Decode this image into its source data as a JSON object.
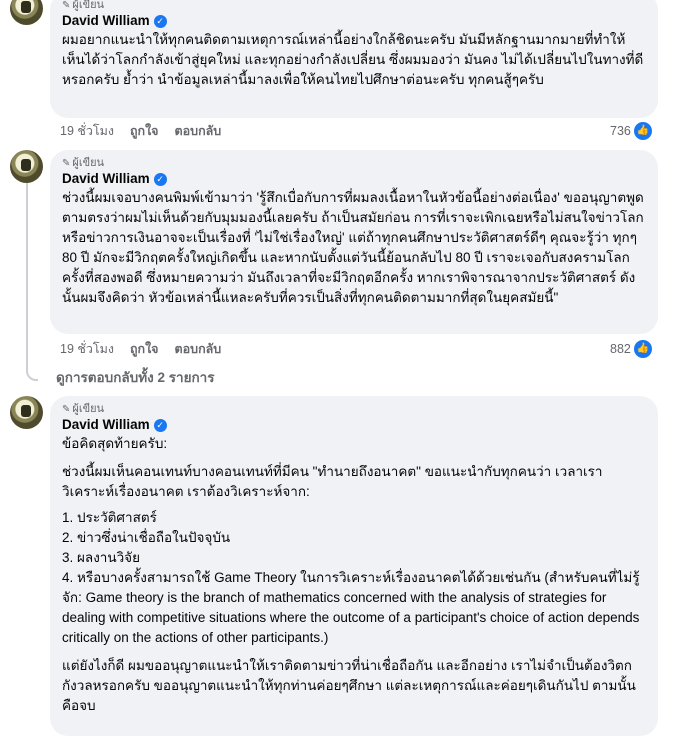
{
  "comments": [
    {
      "badge": "ผู้เขียน",
      "author": "David William",
      "text": "ผมอยากแนะนำให้ทุกคนติดตามเหตุการณ์เหล่านี้อย่างใกล้ชิดนะครับ มันมีหลักฐานมากมายที่ทำให้เห็นได้ว่าโลกกำลังเข้าสู่ยุคใหม่ และทุกอย่างกำลังเปลี่ยน ซึ่งผมมองว่า มันคง ไม่ได้เปลี่ยนไปในทางที่ดีหรอกครับ ย้ำว่า นำข้อมูลเหล่านี้มาลงเพื่อให้คนไทยไปศึกษาต่อนะครับ ทุกคนสู้ๆครับ",
      "time": "19 ชั่วโมง",
      "like": "ถูกใจ",
      "reply": "ตอบกลับ",
      "reactions": "736"
    },
    {
      "badge": "ผู้เขียน",
      "author": "David William",
      "text": "ช่วงนี้ผมเจอบางคนพิมพ์เข้ามาว่า 'รู้สึกเบื่อกับการที่ผมลงเนื้อหาในหัวข้อนี้อย่างต่อเนื่อง' ขออนุญาตพูดตามตรงว่าผมไม่เห็นด้วยกับมุมมองนี้เลยครับ ถ้าเป็นสมัยก่อน การที่เราจะเพิกเฉยหรือไม่สนใจข่าวโลกหรือข่าวการเงินอาจจะเป็นเรื่องที่ 'ไม่ใช่เรื่องใหญ่' แต่ถ้าทุกคนศึกษาประวัติศาสตร์ดีๆ คุณจะรู้ว่า ทุกๆ 80 ปี มักจะมีวิกฤตครั้งใหญ่เกิดขึ้น และหากนับตั้งแต่วันนี้ย้อนกลับไป 80 ปี เราจะเจอกับสงครามโลกครั้งที่สองพอดี ซึ่งหมายความว่า มันถึงเวลาที่จะมีวิกฤตอีกครั้ง หากเราพิจารณาจากประวัติศาสตร์ ดังนั้นผมจึงคิดว่า หัวข้อเหล่านี้แหละครับที่ควรเป็นสิ่งที่ทุกคนติดตามมากที่สุดในยุคสมัยนี้\"",
      "time": "19 ชั่วโมง",
      "like": "ถูกใจ",
      "reply": "ตอบกลับ",
      "reactions": "882"
    }
  ],
  "view_replies": "ดูการตอบกลับทั้ง 2 รายการ",
  "final_comment": {
    "badge": "ผู้เขียน",
    "author": "David William",
    "heading": "ข้อคิดสุดท้ายครับ:",
    "intro": "ช่วงนี้ผมเห็นคอนเทนท์บางคอนเทนท์ที่มีคน \"ทำนายถึงอนาคต\" ขอแนะนำกับทุกคนว่า เวลาเราวิเคราะห์เรื่องอนาคต เราต้องวิเคราะห์จาก:",
    "items": [
      "1. ประวัติศาสตร์",
      "2. ข่าวซึ่งน่าเชื่อถือในปัจจุบัน",
      "3. ผลงานวิจัย",
      "4. หรือบางครั้งสามารถใช้ Game Theory ในการวิเคราะห์เรื่องอนาคตได้ด้วยเช่นกัน (สำหรับคนที่ไม่รู้จัก: Game theory is the branch of mathematics concerned with the analysis of strategies for dealing with competitive situations where the outcome of a participant's choice of action depends critically on the actions of other participants.)"
    ],
    "closing": "แต่ยังไงก็ดี ผมขออนุญาตแนะนำให้เราติดตามข่าวที่น่าเชื่อถือกัน และอีกอย่าง เราไม่จำเป็นต้องวิตกกังวลหรอกครับ ขออนุญาตแนะนำให้ทุกท่านค่อยๆศึกษา แต่ละเหตุการณ์และค่อยๆเดินกันไป ตามนั้นคือจบ"
  },
  "icons": {
    "verified": "verified-badge-icon",
    "like": "thumbs-up-icon",
    "pen": "pen-icon"
  },
  "colors": {
    "accent": "#1877f2",
    "bubble": "#f0f2f5",
    "muted": "#65676b"
  }
}
